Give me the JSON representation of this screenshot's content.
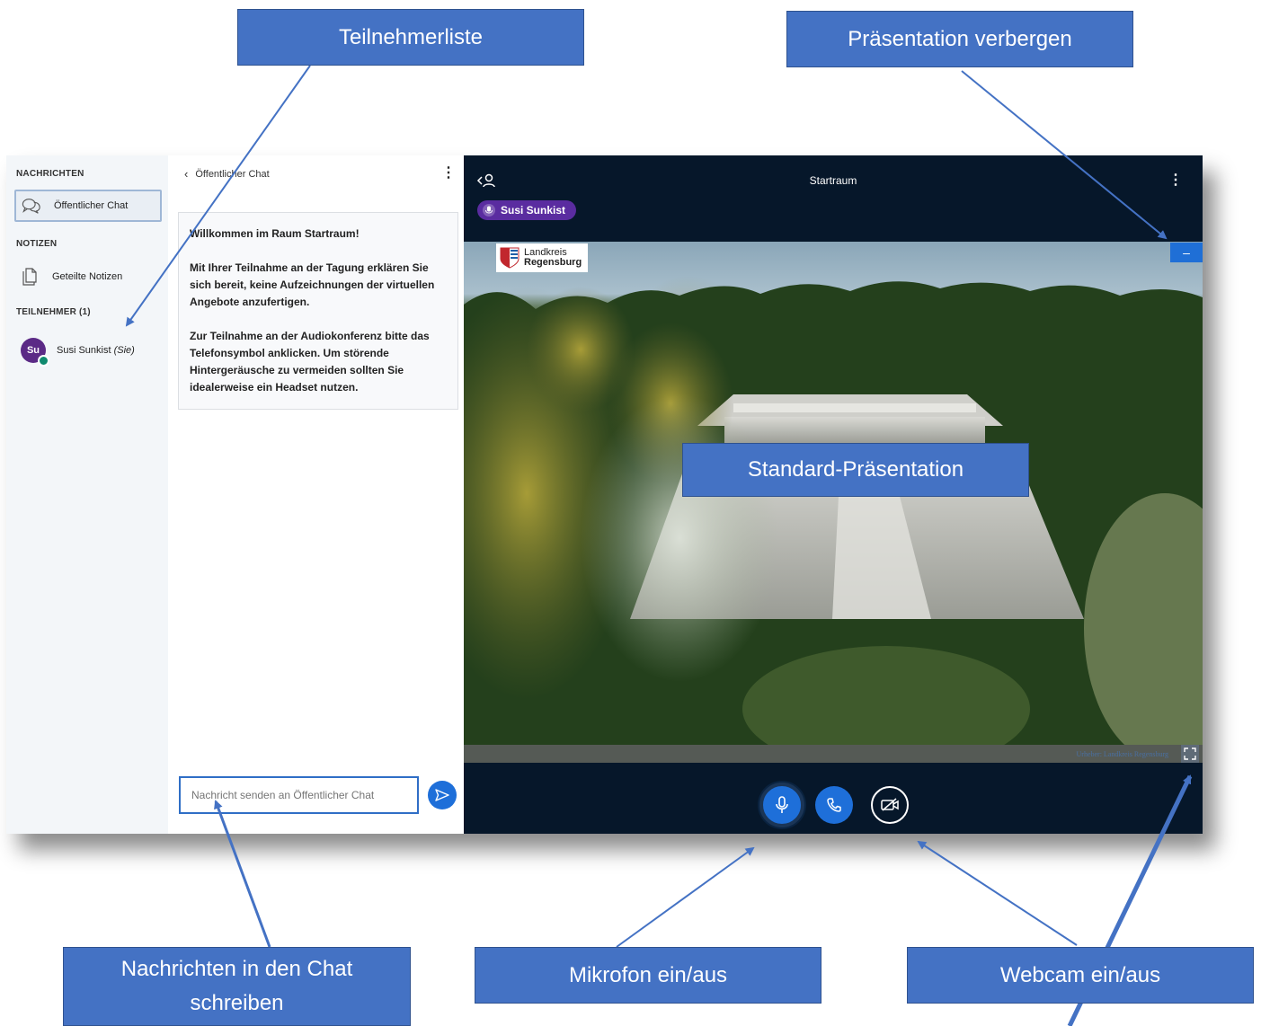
{
  "sidebar": {
    "messages_heading": "NACHRICHTEN",
    "public_chat": "Öffentlicher Chat",
    "notes_heading": "NOTIZEN",
    "shared_notes": "Geteilte Notizen",
    "participants_heading": "TEILNEHMER (1)",
    "user": {
      "initials": "Su",
      "name": "Susi Sunkist",
      "self": "(Sie)"
    }
  },
  "chat": {
    "header": "Öffentlicher Chat",
    "welcome_line1": "Willkommen im Raum Startraum!",
    "welcome_p2": "Mit Ihrer Teilnahme an der Tagung erklären Sie sich bereit, keine Aufzeichnungen der virtuellen Angebote anzufertigen.",
    "welcome_p3": "Zur Teilnahme an der Audiokonferenz bitte das Telefonsymbol anklicken. Um störende Hintergeräusche zu vermeiden sollten Sie idealerweise ein Headset nutzen.",
    "input_placeholder": "Nachricht senden an Öffentlicher Chat"
  },
  "main": {
    "title": "Startraum",
    "talker": "Susi Sunkist",
    "logo_line1": "Landkreis",
    "logo_line2": "Regensburg",
    "credit": "Urheber: Landkreis Regensburg",
    "hide_presentation_symbol": "–"
  },
  "annotations": {
    "participants_list": "Teilnehmerliste",
    "hide_presentation": "Präsentation verbergen",
    "default_presentation": "Standard-Präsentation",
    "write_chat": "Nachrichten in den Chat schreiben",
    "mic_toggle": "Mikrofon ein/aus",
    "webcam_toggle": "Webcam ein/aus"
  },
  "colors": {
    "accent": "#1e6fd9",
    "dark_bg": "#06172a",
    "talker_badge": "#5a2ca0",
    "annotation": "#4472c4"
  }
}
